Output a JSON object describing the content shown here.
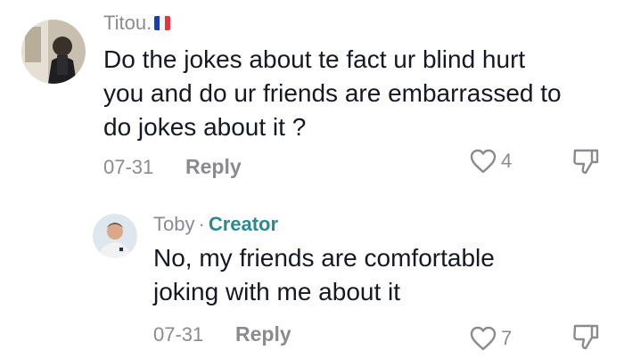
{
  "comments": [
    {
      "username": "Titou.",
      "flag_colors": [
        "#1a3fb0",
        "#ffffff",
        "#e5343c"
      ],
      "avatar_icon": "user-avatar-photo",
      "text_lines": [
        "Do the jokes about te fact ur blind hurt",
        "you and do ur friends are embarrassed to",
        "do jokes about it ?"
      ],
      "date": "07-31",
      "reply_label": "Reply",
      "like_icon": "heart-outline-icon",
      "like_count": "4",
      "dislike_icon": "thumbs-down-icon"
    },
    {
      "username": "Toby",
      "separator": "·",
      "badge": "Creator",
      "badge_color": "#2a8a8f",
      "avatar_icon": "user-avatar-photo",
      "text_lines": [
        "No, my friends are comfortable",
        "joking with me about it"
      ],
      "date": "07-31",
      "reply_label": "Reply",
      "like_icon": "heart-outline-icon",
      "like_count": "7",
      "dislike_icon": "thumbs-down-icon"
    }
  ]
}
